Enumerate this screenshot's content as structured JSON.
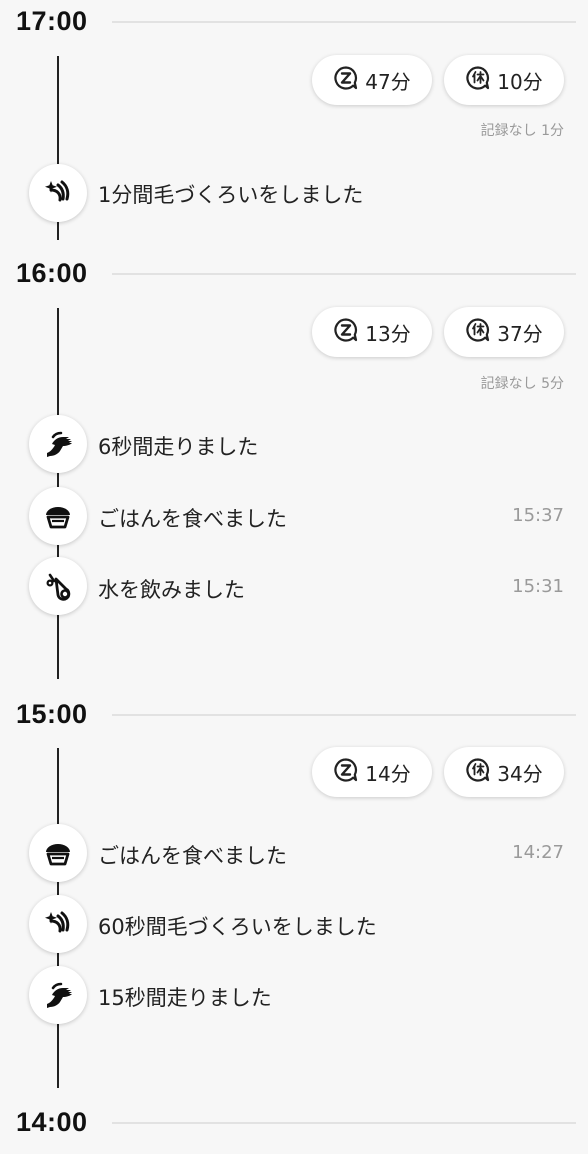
{
  "sections": [
    {
      "hour": "17:00",
      "sleep": "47分",
      "rest": "10分",
      "no_record": "記録なし 1分",
      "events": [
        {
          "icon": "grooming-icon",
          "text": "1分間毛づくろいをしました",
          "time": ""
        }
      ]
    },
    {
      "hour": "16:00",
      "sleep": "13分",
      "rest": "37分",
      "no_record": "記録なし 5分",
      "events": [
        {
          "icon": "running-icon",
          "text": "6秒間走りました",
          "time": ""
        },
        {
          "icon": "food-bowl-icon",
          "text": "ごはんを食べました",
          "time": "15:37"
        },
        {
          "icon": "water-drop-icon",
          "text": "水を飲みました",
          "time": "15:31"
        }
      ]
    },
    {
      "hour": "15:00",
      "sleep": "14分",
      "rest": "34分",
      "events": [
        {
          "icon": "food-bowl-icon",
          "text": "ごはんを食べました",
          "time": "14:27"
        },
        {
          "icon": "grooming-icon",
          "text": "60秒間毛づくろいをしました",
          "time": ""
        },
        {
          "icon": "running-icon",
          "text": "15秒間走りました",
          "time": ""
        }
      ]
    },
    {
      "hour": "14:00"
    }
  ],
  "icons": {
    "sleep": "sleep-z-icon",
    "rest": "rest-kyu-icon"
  },
  "colors": {
    "background": "#f7f7f7",
    "timeline": "#222222",
    "muted_text": "#9a9a9a"
  }
}
